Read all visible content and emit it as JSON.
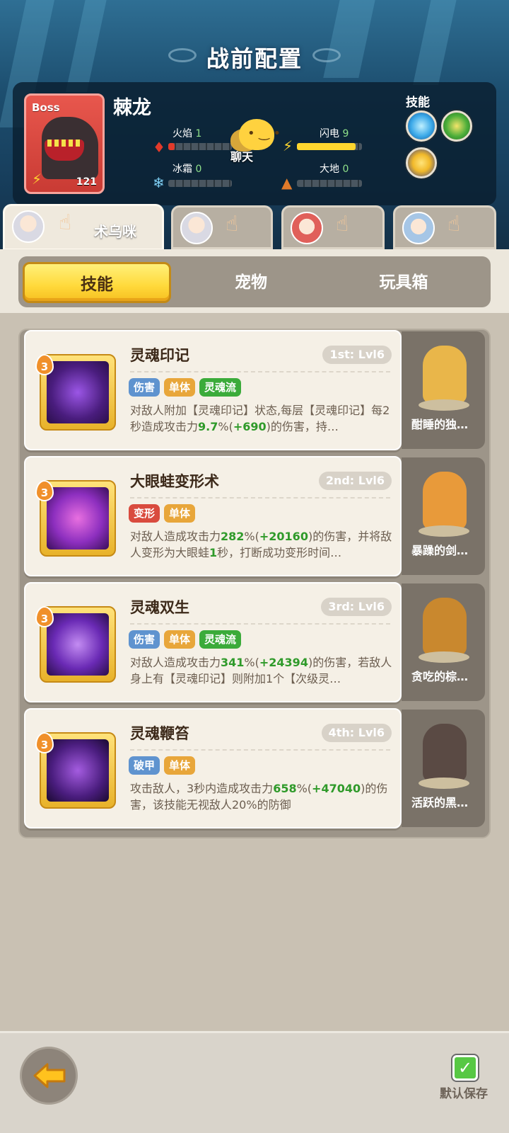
{
  "page_title": "战前配置",
  "boss": {
    "tag": "Boss",
    "name": "棘龙",
    "level": "121",
    "chat_label": "聊天",
    "skills_label": "技能",
    "stats": [
      {
        "name": "火焰",
        "value": "1",
        "fill": 0.1,
        "color": "#e23a2a",
        "icon": "flame-icon"
      },
      {
        "name": "闪电",
        "value": "9",
        "fill": 0.9,
        "color": "#ffd62e",
        "icon": "lightning-icon"
      },
      {
        "name": "冰霜",
        "value": "0",
        "fill": 0.0,
        "color": "#7fd0f5",
        "icon": "snowflake-icon"
      },
      {
        "name": "大地",
        "value": "0",
        "fill": 0.0,
        "color": "#e07a2a",
        "icon": "earth-icon"
      }
    ]
  },
  "characters": [
    {
      "name": "术乌咪",
      "active": true
    },
    {
      "name": "",
      "active": false
    },
    {
      "name": "",
      "active": false
    },
    {
      "name": "",
      "active": false
    }
  ],
  "tabs": [
    "技能",
    "宠物",
    "玩具箱"
  ],
  "skills": [
    {
      "title": "灵魂印记",
      "rank": "1st: Lvl6",
      "level": "3",
      "tags": [
        "伤害",
        "单体",
        "灵魂流"
      ],
      "desc_parts": [
        "对敌人附加【灵魂印记】状态,每层【灵魂印记】每2秒造成攻击力",
        "9.7",
        "%(",
        "+690",
        ")的伤害，持…"
      ]
    },
    {
      "title": "大眼蛙变形术",
      "rank": "2nd: Lvl6",
      "level": "3",
      "tags": [
        "变形",
        "单体"
      ],
      "desc_parts": [
        "对敌人造成攻击力",
        "282",
        "%(",
        "+20160",
        ")的伤害，并将敌人变形为大眼蛙",
        "1",
        "秒，打断成功变形时间…"
      ]
    },
    {
      "title": "灵魂双生",
      "rank": "3rd: Lvl6",
      "level": "3",
      "tags": [
        "伤害",
        "单体",
        "灵魂流"
      ],
      "desc_parts": [
        "对敌人造成攻击力",
        "341",
        "%(",
        "+24394",
        ")的伤害，若敌人身上有【灵魂印记】则附加1个【次级灵…"
      ]
    },
    {
      "title": "灵魂鞭笞",
      "rank": "4th: Lvl6",
      "level": "3",
      "tags": [
        "破甲",
        "单体"
      ],
      "desc_parts": [
        "攻击敌人，3秒内造成攻击力",
        "658",
        "%(",
        "+47040",
        ")的伤害，该技能无视敌人20%的防御"
      ]
    }
  ],
  "pets": [
    "酣睡的独…",
    "暴躁的剑…",
    "贪吃的棕…",
    "活跃的黑…"
  ],
  "bottom": {
    "save_label": "默认保存"
  }
}
